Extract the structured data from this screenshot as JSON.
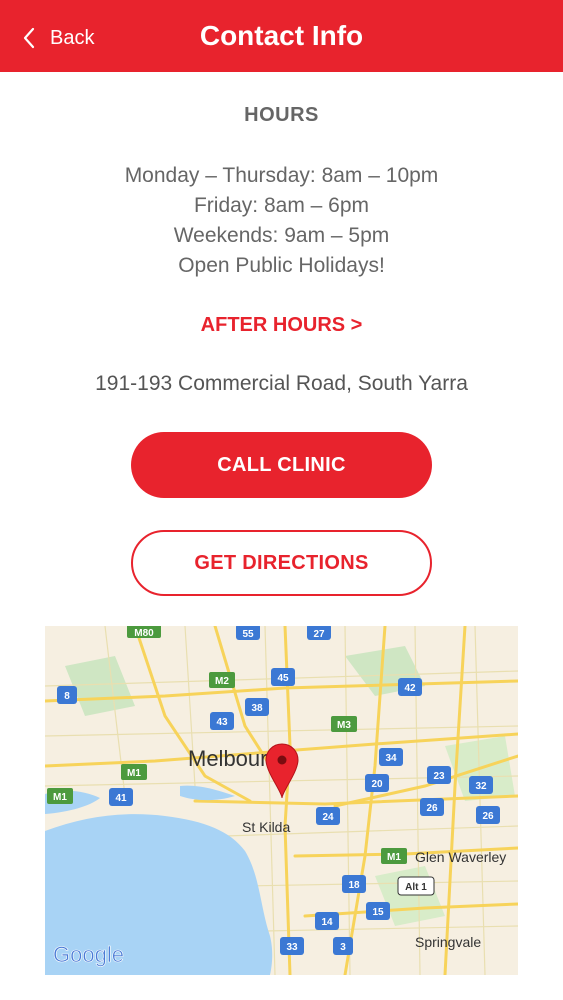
{
  "header": {
    "back_label": "Back",
    "title": "Contact Info"
  },
  "hours": {
    "title": "HOURS",
    "lines": [
      "Monday – Thursday: 8am – 10pm",
      "Friday: 8am – 6pm",
      "Weekends: 9am – 5pm",
      "Open Public Holidays!"
    ]
  },
  "after_hours_label": "AFTER HOURS >",
  "address": "191-193 Commercial Road, South Yarra",
  "buttons": {
    "call": "CALL CLINIC",
    "directions": "GET DIRECTIONS"
  },
  "map": {
    "places": [
      "Melbourne",
      "St Kilda",
      "Glen Waverley",
      "Springvale"
    ],
    "brand": "Google",
    "routes": [
      "M80",
      "55",
      "27",
      "8",
      "M2",
      "45",
      "42",
      "38",
      "43",
      "M3",
      "34",
      "M1",
      "41",
      "20",
      "23",
      "32",
      "M1",
      "24",
      "26",
      "26",
      "M1",
      "18",
      "Alt 1",
      "15",
      "14",
      "33",
      "3"
    ],
    "colors": {
      "primary": "#e8232d",
      "water": "#a8d3f5",
      "land": "#f6efe1"
    }
  }
}
